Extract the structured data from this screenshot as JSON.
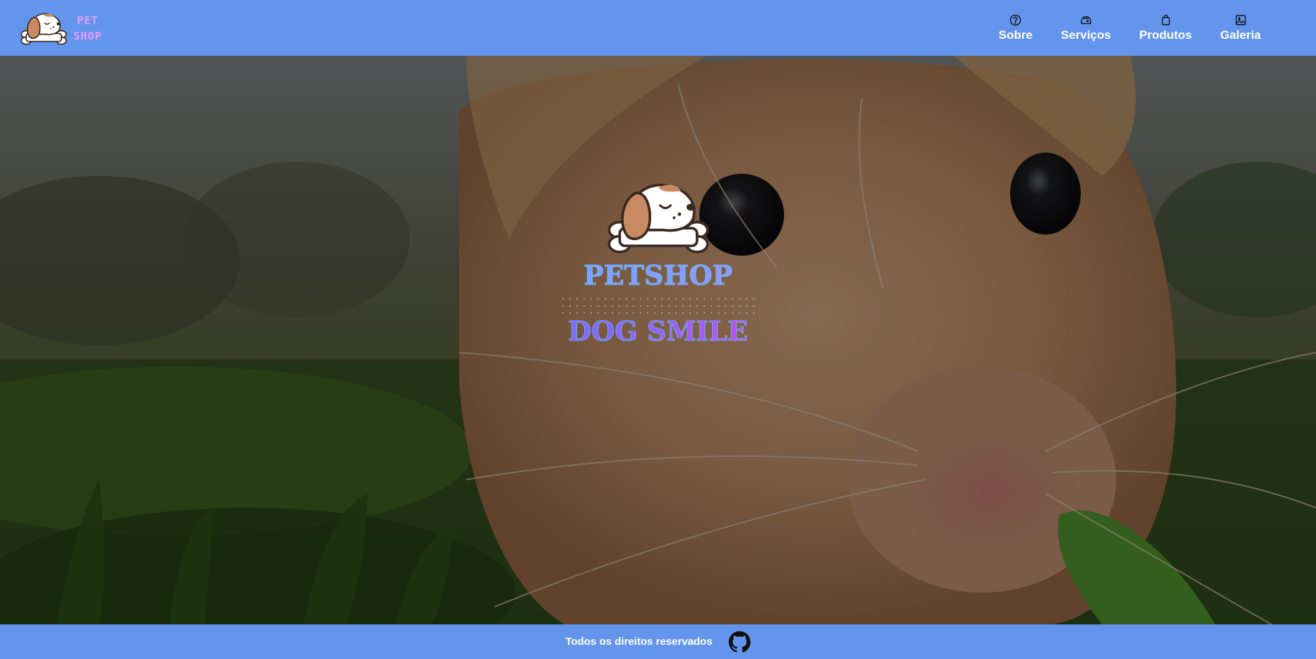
{
  "colors": {
    "bar": "#6495ed",
    "brand_text": "#e79bff",
    "hero_gradient_start": "#7b6cff",
    "hero_gradient_end": "#b257f0"
  },
  "brand": {
    "line1": "PET",
    "line2": "SHOP",
    "logo_icon": "sleeping-dog-with-bone-icon"
  },
  "nav": {
    "items": [
      {
        "label": "Sobre",
        "icon": "question-circle-icon"
      },
      {
        "label": "Serviços",
        "icon": "pet-service-icon"
      },
      {
        "label": "Produtos",
        "icon": "shopping-bag-icon"
      },
      {
        "label": "Galeria",
        "icon": "image-icon"
      }
    ]
  },
  "hero": {
    "title": "PETSHOP",
    "subtitle": "DOG SMILE",
    "background": "guinea-pig-closeup-photo"
  },
  "footer": {
    "text": "Todos os direitos reservados",
    "icon": "github-icon"
  }
}
